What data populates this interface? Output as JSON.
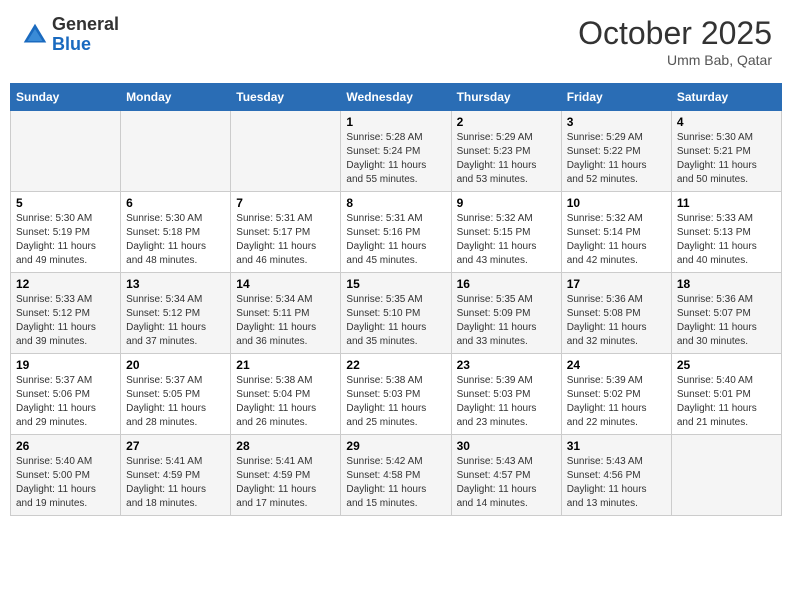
{
  "header": {
    "logo_line1": "General",
    "logo_line2": "Blue",
    "month": "October 2025",
    "location": "Umm Bab, Qatar"
  },
  "weekdays": [
    "Sunday",
    "Monday",
    "Tuesday",
    "Wednesday",
    "Thursday",
    "Friday",
    "Saturday"
  ],
  "weeks": [
    [
      {
        "day": "",
        "info": ""
      },
      {
        "day": "",
        "info": ""
      },
      {
        "day": "",
        "info": ""
      },
      {
        "day": "1",
        "info": "Sunrise: 5:28 AM\nSunset: 5:24 PM\nDaylight: 11 hours and 55 minutes."
      },
      {
        "day": "2",
        "info": "Sunrise: 5:29 AM\nSunset: 5:23 PM\nDaylight: 11 hours and 53 minutes."
      },
      {
        "day": "3",
        "info": "Sunrise: 5:29 AM\nSunset: 5:22 PM\nDaylight: 11 hours and 52 minutes."
      },
      {
        "day": "4",
        "info": "Sunrise: 5:30 AM\nSunset: 5:21 PM\nDaylight: 11 hours and 50 minutes."
      }
    ],
    [
      {
        "day": "5",
        "info": "Sunrise: 5:30 AM\nSunset: 5:19 PM\nDaylight: 11 hours and 49 minutes."
      },
      {
        "day": "6",
        "info": "Sunrise: 5:30 AM\nSunset: 5:18 PM\nDaylight: 11 hours and 48 minutes."
      },
      {
        "day": "7",
        "info": "Sunrise: 5:31 AM\nSunset: 5:17 PM\nDaylight: 11 hours and 46 minutes."
      },
      {
        "day": "8",
        "info": "Sunrise: 5:31 AM\nSunset: 5:16 PM\nDaylight: 11 hours and 45 minutes."
      },
      {
        "day": "9",
        "info": "Sunrise: 5:32 AM\nSunset: 5:15 PM\nDaylight: 11 hours and 43 minutes."
      },
      {
        "day": "10",
        "info": "Sunrise: 5:32 AM\nSunset: 5:14 PM\nDaylight: 11 hours and 42 minutes."
      },
      {
        "day": "11",
        "info": "Sunrise: 5:33 AM\nSunset: 5:13 PM\nDaylight: 11 hours and 40 minutes."
      }
    ],
    [
      {
        "day": "12",
        "info": "Sunrise: 5:33 AM\nSunset: 5:12 PM\nDaylight: 11 hours and 39 minutes."
      },
      {
        "day": "13",
        "info": "Sunrise: 5:34 AM\nSunset: 5:12 PM\nDaylight: 11 hours and 37 minutes."
      },
      {
        "day": "14",
        "info": "Sunrise: 5:34 AM\nSunset: 5:11 PM\nDaylight: 11 hours and 36 minutes."
      },
      {
        "day": "15",
        "info": "Sunrise: 5:35 AM\nSunset: 5:10 PM\nDaylight: 11 hours and 35 minutes."
      },
      {
        "day": "16",
        "info": "Sunrise: 5:35 AM\nSunset: 5:09 PM\nDaylight: 11 hours and 33 minutes."
      },
      {
        "day": "17",
        "info": "Sunrise: 5:36 AM\nSunset: 5:08 PM\nDaylight: 11 hours and 32 minutes."
      },
      {
        "day": "18",
        "info": "Sunrise: 5:36 AM\nSunset: 5:07 PM\nDaylight: 11 hours and 30 minutes."
      }
    ],
    [
      {
        "day": "19",
        "info": "Sunrise: 5:37 AM\nSunset: 5:06 PM\nDaylight: 11 hours and 29 minutes."
      },
      {
        "day": "20",
        "info": "Sunrise: 5:37 AM\nSunset: 5:05 PM\nDaylight: 11 hours and 28 minutes."
      },
      {
        "day": "21",
        "info": "Sunrise: 5:38 AM\nSunset: 5:04 PM\nDaylight: 11 hours and 26 minutes."
      },
      {
        "day": "22",
        "info": "Sunrise: 5:38 AM\nSunset: 5:03 PM\nDaylight: 11 hours and 25 minutes."
      },
      {
        "day": "23",
        "info": "Sunrise: 5:39 AM\nSunset: 5:03 PM\nDaylight: 11 hours and 23 minutes."
      },
      {
        "day": "24",
        "info": "Sunrise: 5:39 AM\nSunset: 5:02 PM\nDaylight: 11 hours and 22 minutes."
      },
      {
        "day": "25",
        "info": "Sunrise: 5:40 AM\nSunset: 5:01 PM\nDaylight: 11 hours and 21 minutes."
      }
    ],
    [
      {
        "day": "26",
        "info": "Sunrise: 5:40 AM\nSunset: 5:00 PM\nDaylight: 11 hours and 19 minutes."
      },
      {
        "day": "27",
        "info": "Sunrise: 5:41 AM\nSunset: 4:59 PM\nDaylight: 11 hours and 18 minutes."
      },
      {
        "day": "28",
        "info": "Sunrise: 5:41 AM\nSunset: 4:59 PM\nDaylight: 11 hours and 17 minutes."
      },
      {
        "day": "29",
        "info": "Sunrise: 5:42 AM\nSunset: 4:58 PM\nDaylight: 11 hours and 15 minutes."
      },
      {
        "day": "30",
        "info": "Sunrise: 5:43 AM\nSunset: 4:57 PM\nDaylight: 11 hours and 14 minutes."
      },
      {
        "day": "31",
        "info": "Sunrise: 5:43 AM\nSunset: 4:56 PM\nDaylight: 11 hours and 13 minutes."
      },
      {
        "day": "",
        "info": ""
      }
    ]
  ]
}
